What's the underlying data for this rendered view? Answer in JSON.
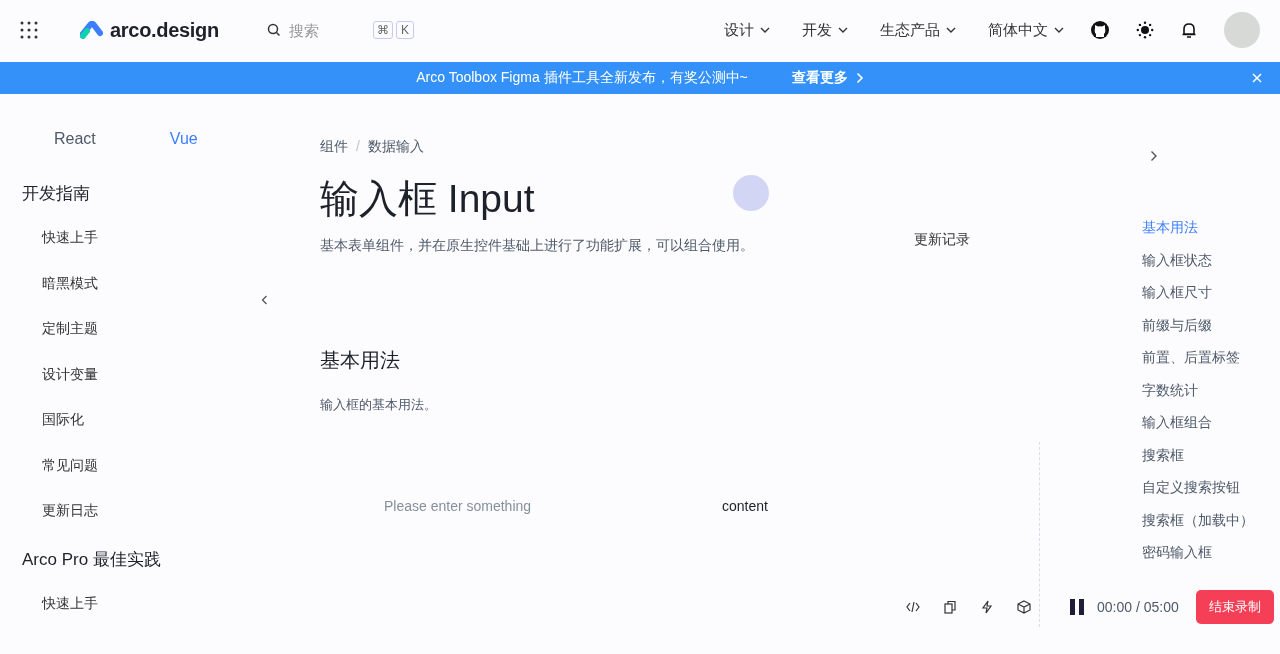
{
  "header": {
    "logo": "arco.design",
    "search": {
      "placeholder": "搜索"
    },
    "shortcut_keys": [
      "⌘",
      "K"
    ],
    "nav": [
      {
        "label": "设计"
      },
      {
        "label": "开发"
      },
      {
        "label": "生态产品"
      },
      {
        "label": "简体中文"
      }
    ]
  },
  "banner": {
    "text": "Arco Toolbox Figma 插件工具全新发布，有奖公测中~",
    "link": "查看更多"
  },
  "sidebar": {
    "tabs": [
      {
        "label": "React",
        "selected": false
      },
      {
        "label": "Vue",
        "selected": true
      }
    ],
    "sections": [
      {
        "title": "开发指南",
        "items": [
          "快速上手",
          "暗黑模式",
          "定制主题",
          "设计变量",
          "国际化",
          "常见问题",
          "更新日志"
        ]
      },
      {
        "title": "Arco Pro 最佳实践",
        "items": [
          "快速上手"
        ]
      }
    ]
  },
  "main": {
    "breadcrumb": [
      "组件",
      "数据输入"
    ],
    "breadcrumb_separator": "/",
    "title": "输入框 Input",
    "description": "基本表单组件，并在原生控件基础上进行了功能扩展，可以组合使用。",
    "changelog_link": "更新记录",
    "section": {
      "title": "基本用法",
      "description": "输入框的基本用法。"
    },
    "demo": {
      "placeholder": "Please enter something",
      "value": "content"
    }
  },
  "toc": [
    {
      "label": "基本用法",
      "selected": true
    },
    {
      "label": "输入框状态",
      "selected": false
    },
    {
      "label": "输入框尺寸",
      "selected": false
    },
    {
      "label": "前缀与后缀",
      "selected": false
    },
    {
      "label": "前置、后置标签",
      "selected": false
    },
    {
      "label": "字数统计",
      "selected": false
    },
    {
      "label": "输入框组合",
      "selected": false
    },
    {
      "label": "搜索框",
      "selected": false
    },
    {
      "label": "自定义搜索按钮",
      "selected": false
    },
    {
      "label": "搜索框（加载中）",
      "selected": false
    },
    {
      "label": "密码输入框",
      "selected": false
    }
  ],
  "recorder": {
    "time": "00:00 / 05:00",
    "stop_button": "结束录制"
  }
}
